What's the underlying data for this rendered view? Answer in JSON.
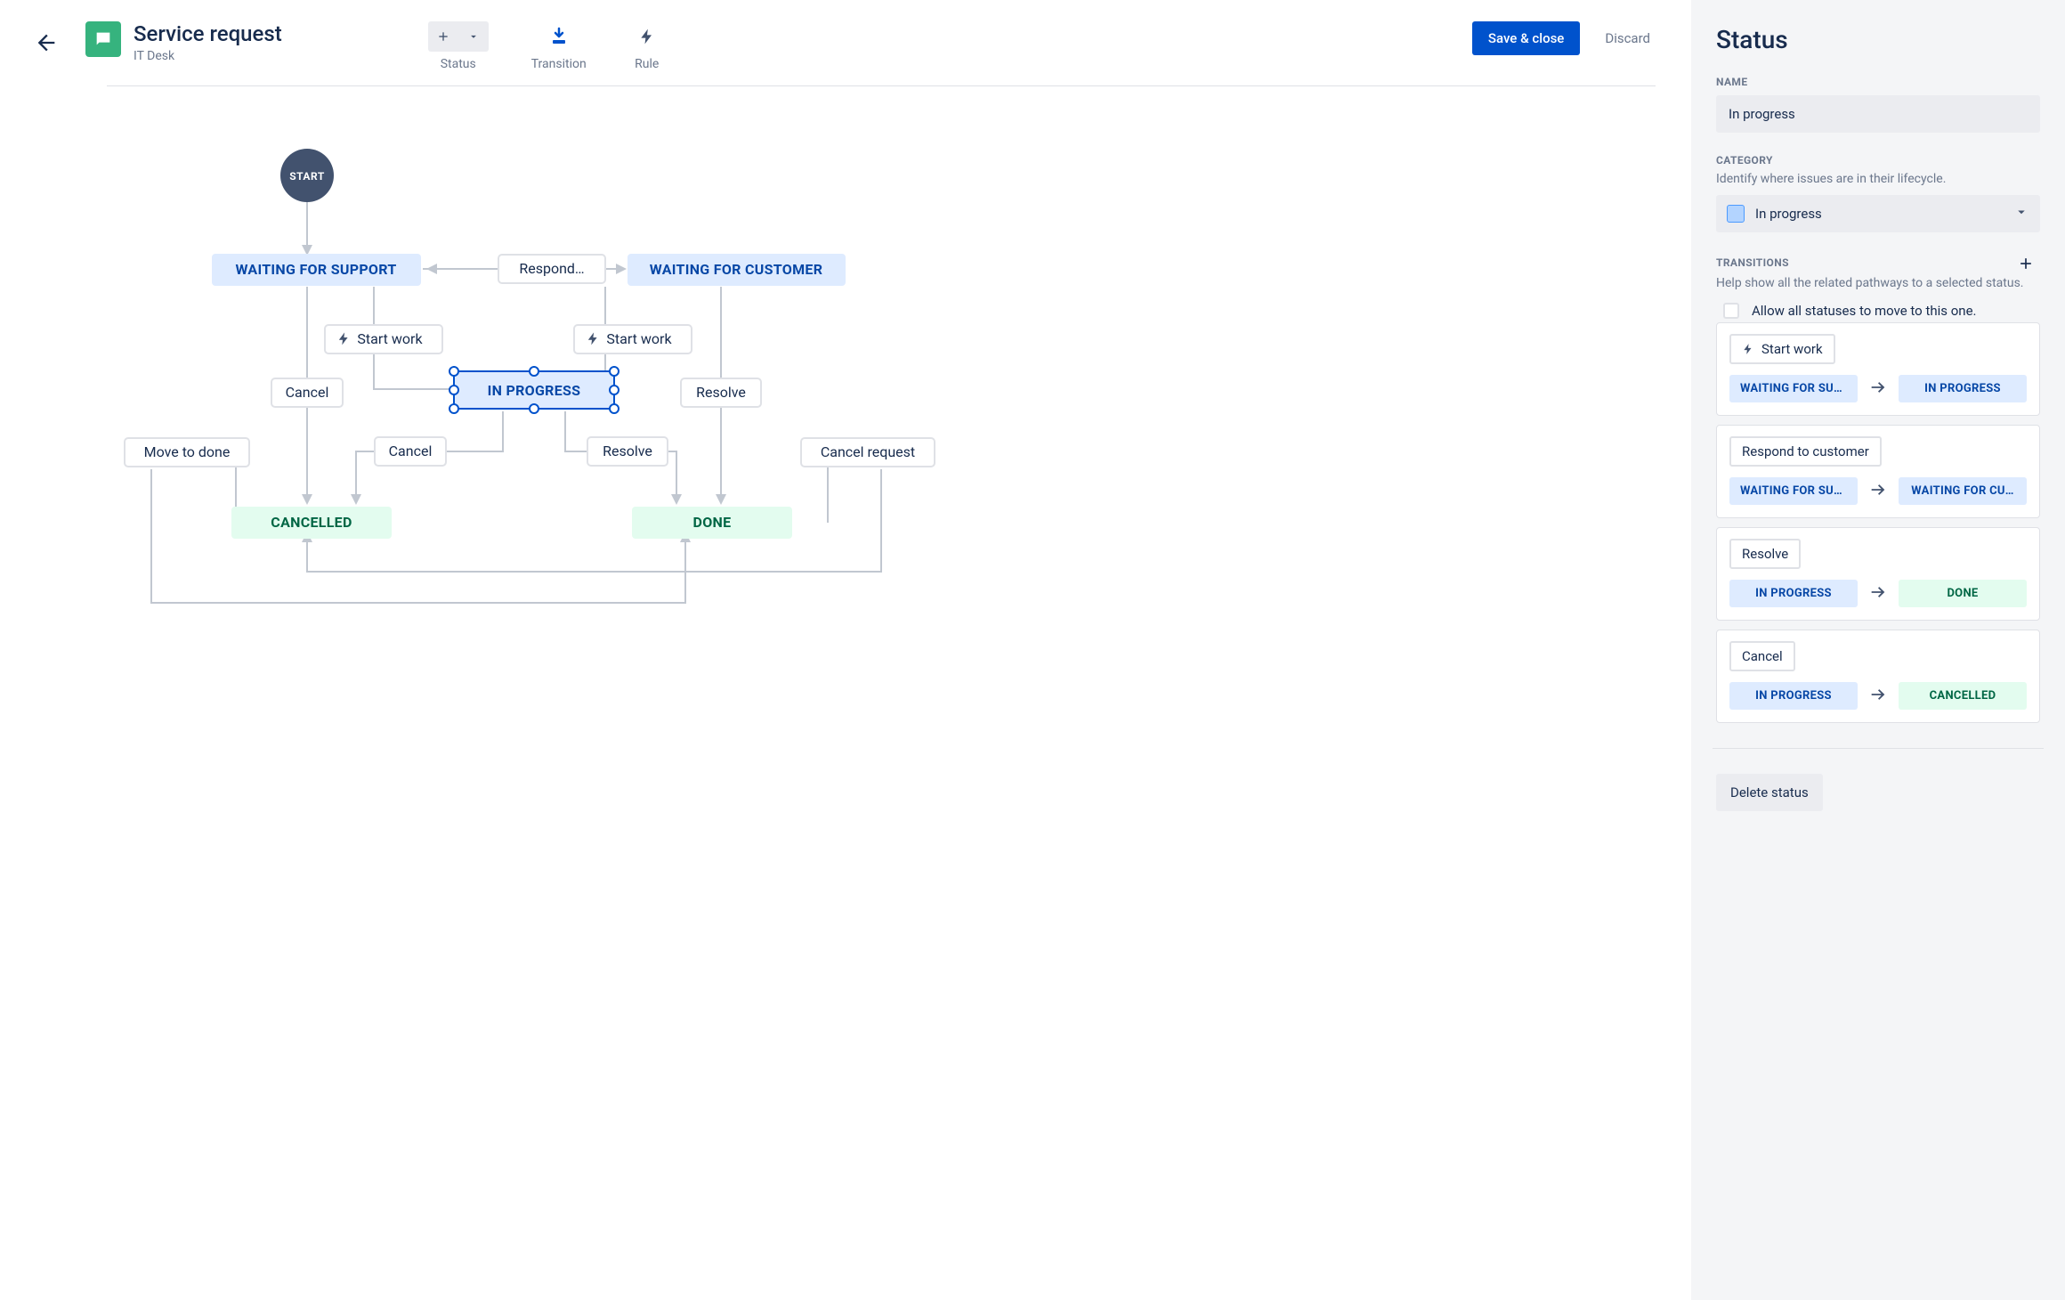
{
  "header": {
    "title": "Service request",
    "subtitle": "IT Desk",
    "toolbar": {
      "status": "Status",
      "transition": "Transition",
      "rule": "Rule"
    },
    "save_close": "Save & close",
    "discard": "Discard"
  },
  "workflow": {
    "start": "START",
    "nodes": {
      "waiting_support": "WAITING FOR SUPPORT",
      "waiting_customer": "WAITING FOR CUSTOMER",
      "in_progress": "IN PROGRESS",
      "cancelled": "CANCELLED",
      "done": "DONE"
    },
    "transitions": {
      "respond": "Respond…",
      "start_work_1": "Start work",
      "start_work_2": "Start work",
      "cancel_1": "Cancel",
      "cancel_2": "Cancel",
      "resolve_1": "Resolve",
      "resolve_2": "Resolve",
      "move_to_done": "Move to done",
      "cancel_request": "Cancel request"
    }
  },
  "panel": {
    "title": "Status",
    "name_label": "NAME",
    "name_value": "In progress",
    "category_label": "CATEGORY",
    "category_help": "Identify where issues are in their lifecycle.",
    "category_value": "In progress",
    "transitions_label": "TRANSITIONS",
    "transitions_help": "Help show all the related pathways to a selected status.",
    "allow_all": "Allow all statuses to move to this one.",
    "delete": "Delete status",
    "items": [
      {
        "name": "Start work",
        "from": "WAITING FOR SUP…",
        "from_cat": "blue",
        "to": "IN PROGRESS",
        "to_cat": "blue",
        "rule": true
      },
      {
        "name": "Respond to customer",
        "from": "WAITING FOR SUP…",
        "from_cat": "blue",
        "to": "WAITING FOR CU…",
        "to_cat": "blue",
        "rule": false
      },
      {
        "name": "Resolve",
        "from": "IN PROGRESS",
        "from_cat": "blue",
        "to": "DONE",
        "to_cat": "green",
        "rule": false
      },
      {
        "name": "Cancel",
        "from": "IN PROGRESS",
        "from_cat": "blue",
        "to": "CANCELLED",
        "to_cat": "green",
        "rule": false
      }
    ]
  }
}
